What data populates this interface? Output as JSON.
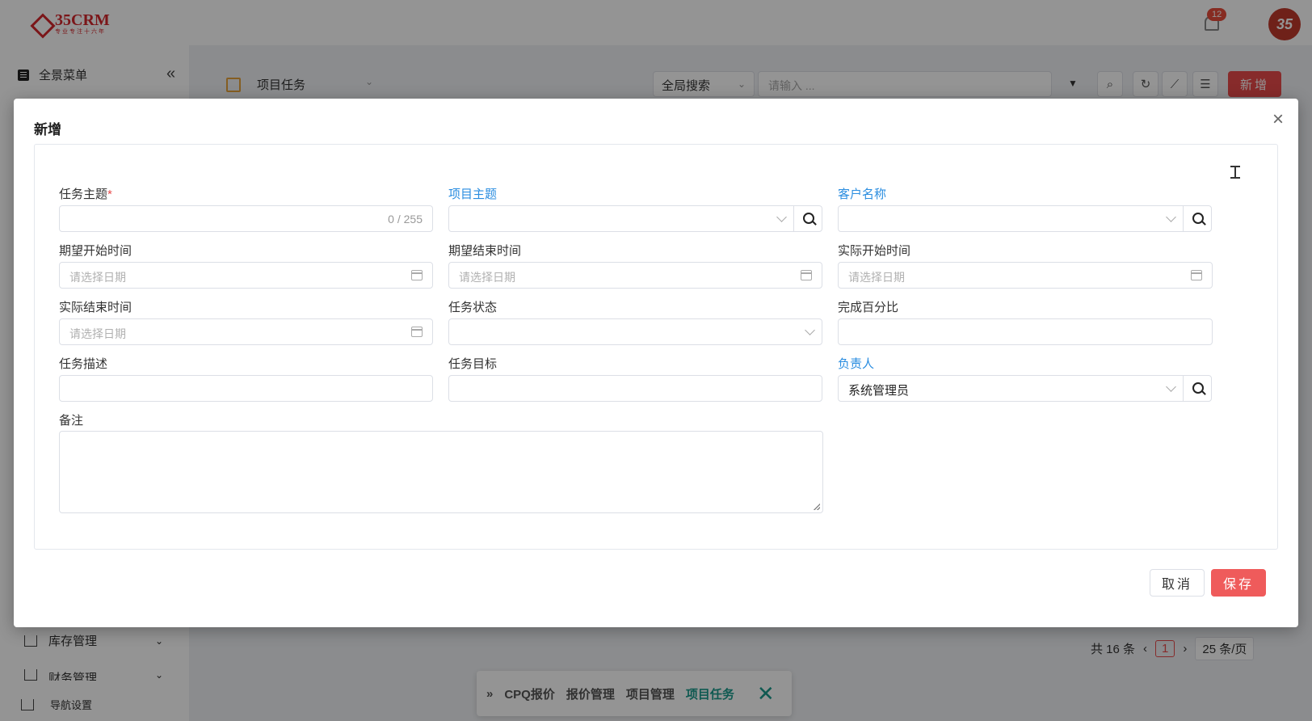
{
  "app": {
    "logo_text": "35CRM",
    "logo_sub": "专业专注十六年",
    "notification_count": "12",
    "avatar_text": "35"
  },
  "sidebar": {
    "menu_title": "全景菜单",
    "items": [
      {
        "label": "库存管理"
      },
      {
        "label": "财务管理"
      },
      {
        "label": "导航设置"
      }
    ]
  },
  "toolbar": {
    "module_title": "项目任务",
    "search_scope": "全局搜索",
    "search_placeholder": "请输入 ...",
    "new_label": "新增"
  },
  "pager": {
    "total": "共 16 条",
    "page": "1",
    "page_size": "25 条/页"
  },
  "breadcrumb": [
    "CPQ报价",
    "报价管理",
    "项目管理",
    "项目任务"
  ],
  "dialog": {
    "title": "新增",
    "fields": {
      "task_subject": {
        "label": "任务主题",
        "counter": "0 / 255"
      },
      "project_subject": {
        "label": "项目主题"
      },
      "customer_name": {
        "label": "客户名称"
      },
      "expected_start": {
        "label": "期望开始时间",
        "placeholder": "请选择日期"
      },
      "expected_end": {
        "label": "期望结束时间",
        "placeholder": "请选择日期"
      },
      "actual_start": {
        "label": "实际开始时间",
        "placeholder": "请选择日期"
      },
      "actual_end": {
        "label": "实际结束时间",
        "placeholder": "请选择日期"
      },
      "task_status": {
        "label": "任务状态"
      },
      "completion_pct": {
        "label": "完成百分比"
      },
      "task_desc": {
        "label": "任务描述"
      },
      "task_goal": {
        "label": "任务目标"
      },
      "owner": {
        "label": "负责人",
        "value": "系统管理员"
      },
      "remarks": {
        "label": "备注"
      }
    },
    "required_mark": "*",
    "cancel_label": "取消",
    "save_label": "保存"
  },
  "colors": {
    "primary_red": "#e84a4a",
    "link_blue": "#2a8de0",
    "active_teal": "#1a9a8c"
  }
}
